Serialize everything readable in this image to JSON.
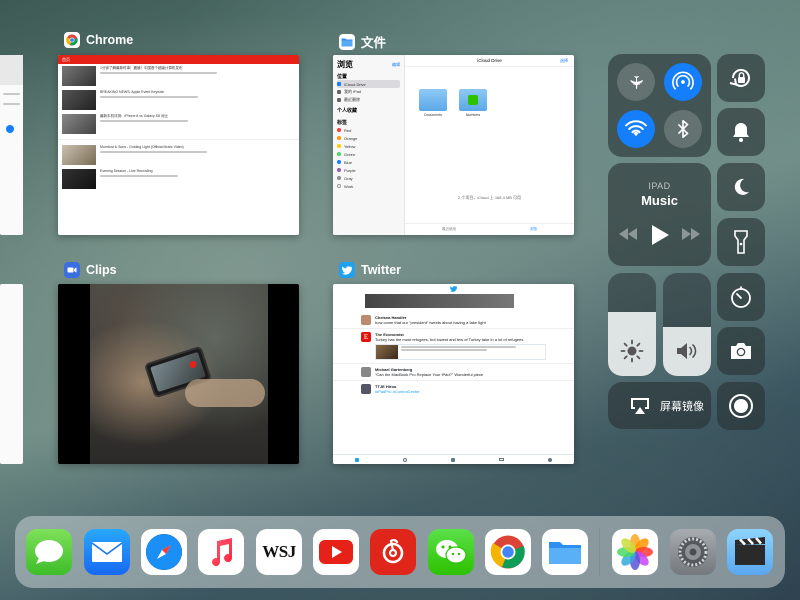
{
  "apps": {
    "chrome": {
      "label": "Chrome",
      "page_title": "首页",
      "videos": [
        "1分钟了解最新时事！震撼！中国首个超级计算机发布",
        "BREAKING NEWS: Apple Event Keynote",
        "最新手机评测：iPhone 8 vs Galaxy S8 对比",
        "Mumford & Sons - Guiding Light (Official Music Video)",
        "Evening Session - Live Recording"
      ]
    },
    "files": {
      "label": "文件",
      "sidebar_title": "浏览",
      "edit": "编辑",
      "header": "iCloud Drive",
      "select": "选择",
      "section_locations": "位置",
      "locations": [
        "iCloud Drive",
        "我的 iPad",
        "最近删除"
      ],
      "section_favorites": "个人收藏",
      "section_tags": "标签",
      "tags": [
        "Red",
        "Orange",
        "Yellow",
        "Green",
        "Blue",
        "Purple",
        "Gray",
        "Work"
      ],
      "folders": [
        "Documents",
        "Numbers"
      ],
      "footer": "2 个项目，iCloud 上 168.4 MB 可用",
      "tab_recents": "最近使用",
      "tab_browse": "浏览"
    },
    "clips": {
      "label": "Clips"
    },
    "twitter": {
      "label": "Twitter",
      "tweets": [
        {
          "name": "Chelsea Handler",
          "text": "how come that our \"president\" tweets about having a fake fight"
        },
        {
          "name": "The Economist",
          "text": "Turkey has the most refugees, but lowest and few of Turkey take in a lot of refugees"
        },
        {
          "name": "Michael Gartenberg",
          "text": "\"Can the MacBook Pro Replace Your iPad?\" Wonderful piece"
        },
        {
          "name": "TTJE Hiroo",
          "text": "#iPadPro #ControlCenter"
        }
      ]
    }
  },
  "control_center": {
    "music_device": "IPAD",
    "music_title": "Music",
    "mirroring": "屏幕镜像",
    "brightness": 0.62,
    "volume": 0.48
  },
  "dock": {
    "left": [
      "messages-icon",
      "mail-icon",
      "safari-icon",
      "music-icon",
      "wsj-icon",
      "youtube-icon",
      "netease-music-icon",
      "wechat-icon",
      "chrome-icon",
      "files-icon"
    ],
    "right": [
      "photos-icon",
      "settings-icon",
      "clips-icon"
    ],
    "wsj_text": "WSJ"
  },
  "colors": {
    "ios_blue": "#147efb",
    "youtube_red": "#e62117",
    "twitter_blue": "#1da1f2",
    "wechat_green": "#2dc100"
  }
}
